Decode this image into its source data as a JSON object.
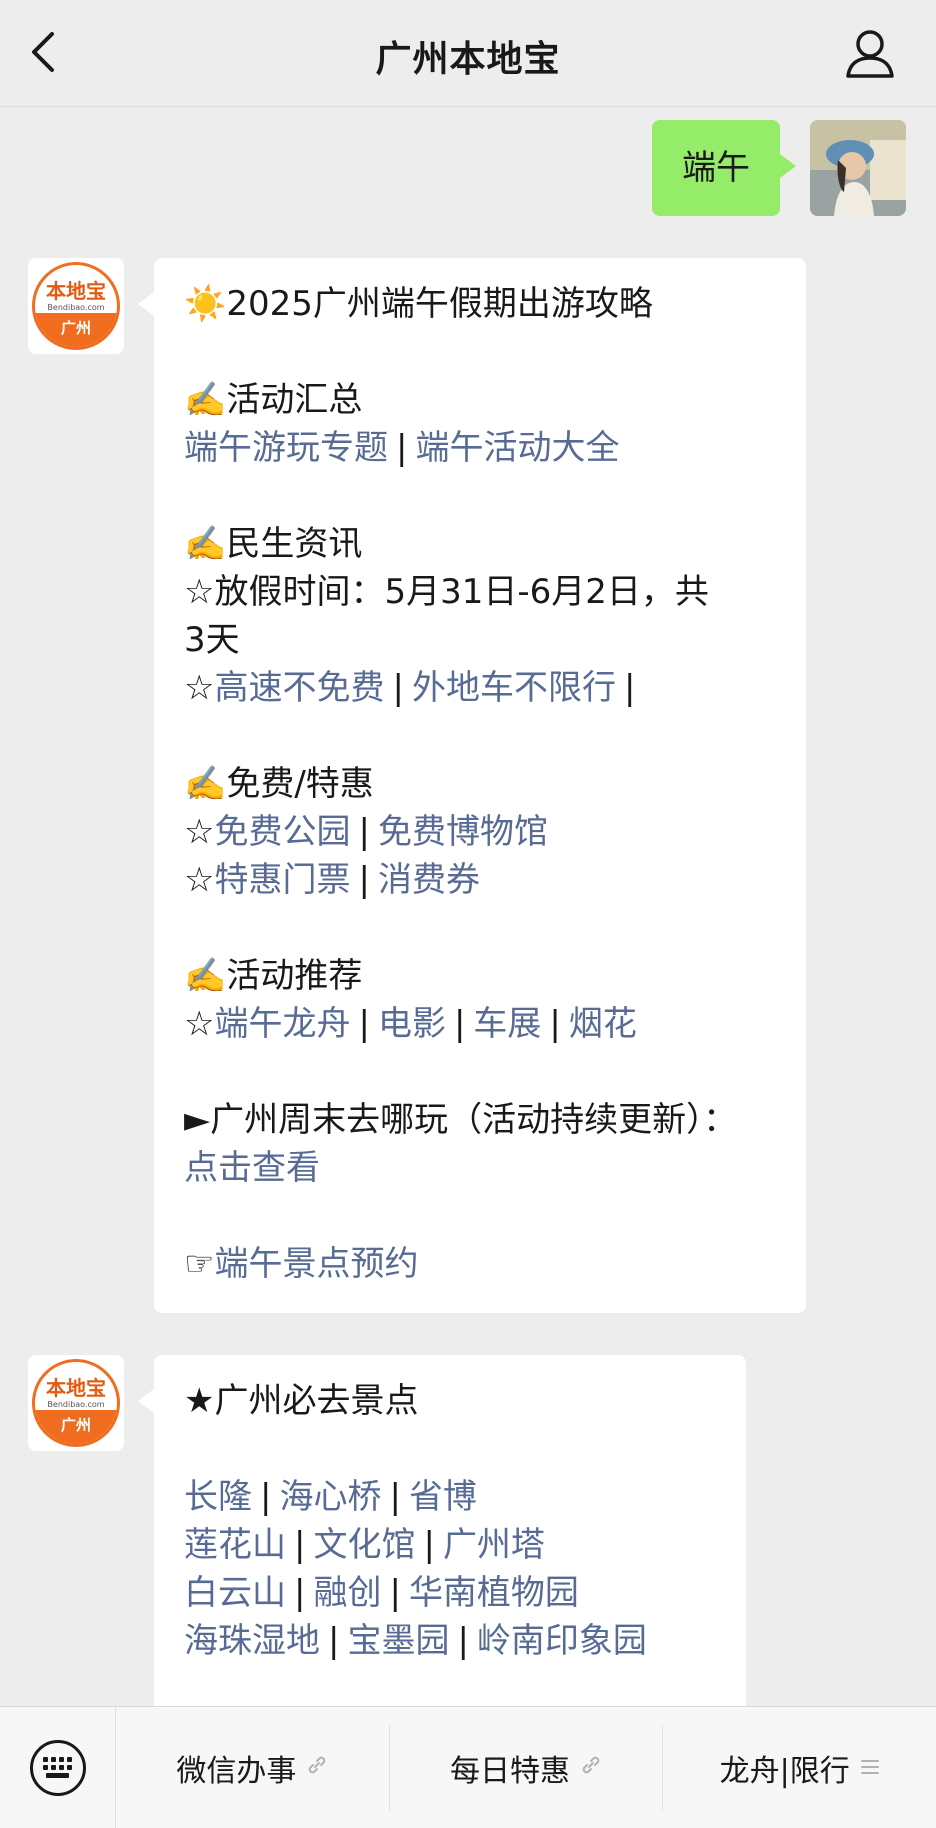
{
  "header": {
    "title": "广州本地宝"
  },
  "user_message": {
    "text": "端午"
  },
  "bot_logo": {
    "top": "本地宝",
    "middle": "Bendibao.com",
    "bottom": "广州"
  },
  "message1": {
    "title": "☀️2025广州端午假期出游攻略",
    "activities": {
      "heading": "✍️活动汇总",
      "links": [
        "端午游玩专题",
        "端午活动大全"
      ]
    },
    "livelihood": {
      "heading": "✍️民生资讯",
      "holiday_line1": "☆放假时间：5月31日-6月2日，共",
      "holiday_line2": "3天",
      "star": "☆",
      "links": [
        "高速不免费",
        "外地车不限行"
      ]
    },
    "free": {
      "heading": "✍️免费/特惠",
      "star": "☆",
      "row1": [
        "免费公园",
        "免费博物馆"
      ],
      "row2": [
        "特惠门票",
        "消费券"
      ]
    },
    "recommend": {
      "heading": "✍️活动推荐",
      "star": "☆",
      "links": [
        "端午龙舟",
        "电影",
        "车展",
        "烟花"
      ]
    },
    "weekend": {
      "text": "►广州周末去哪玩（活动持续更新）：",
      "link": "点击查看"
    },
    "booking": {
      "icon": "☞",
      "link": "端午景点预约"
    }
  },
  "message2": {
    "title": "★广州必去景点",
    "rows": [
      [
        "长隆",
        "海心桥",
        "省博"
      ],
      [
        "莲花山",
        "文化馆",
        "广州塔"
      ],
      [
        "白云山",
        "融创",
        "华南植物园"
      ],
      [
        "海珠湿地",
        "宝墨园",
        "岭南印象园"
      ]
    ]
  },
  "bottom_menu": {
    "items": [
      {
        "label": "微信办事",
        "icon": "link-icon"
      },
      {
        "label": "每日特惠",
        "icon": "link-icon"
      },
      {
        "label": "龙舟|限行",
        "icon": "submenu-icon"
      }
    ]
  },
  "separator": "|"
}
